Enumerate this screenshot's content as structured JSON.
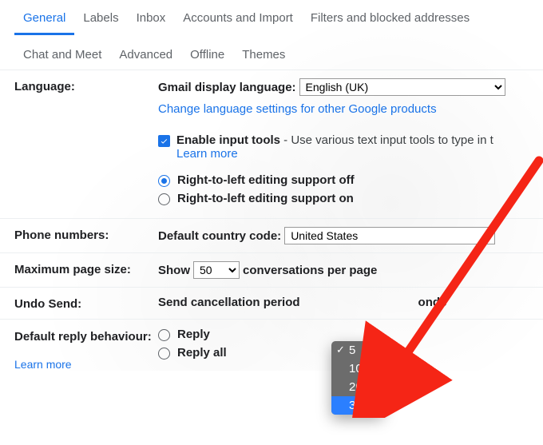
{
  "tabs": {
    "row1": [
      "General",
      "Labels",
      "Inbox",
      "Accounts and Import",
      "Filters and blocked addresses"
    ],
    "row2": [
      "Chat and Meet",
      "Advanced",
      "Offline",
      "Themes"
    ],
    "active": "General"
  },
  "language": {
    "label": "Language:",
    "display_label": "Gmail display language:",
    "display_value": "English (UK)",
    "change_link": "Change language settings for other Google products",
    "enable_tools_label": "Enable input tools",
    "enable_tools_desc": " - Use various text input tools to type in t",
    "learn_more": "Learn more",
    "rtl_off": "Right-to-left editing support off",
    "rtl_on": "Right-to-left editing support on"
  },
  "phone": {
    "label": "Phone numbers:",
    "field_label": "Default country code:",
    "value": "United States"
  },
  "pagesize": {
    "label": "Maximum page size:",
    "prefix": "Show",
    "value": "50",
    "suffix": "conversations per page"
  },
  "undo": {
    "label": "Undo Send:",
    "prefix": "Send cancellation period",
    "suffix": "onds",
    "options": [
      "5",
      "10",
      "20",
      "30"
    ],
    "selected": "5",
    "highlighted": "30"
  },
  "reply": {
    "label": "Default reply behaviour:",
    "learn_more": "Learn more",
    "reply": "Reply",
    "reply_all": "Reply all"
  },
  "colors": {
    "accent": "#1a73e8",
    "arrow": "#f52516"
  }
}
